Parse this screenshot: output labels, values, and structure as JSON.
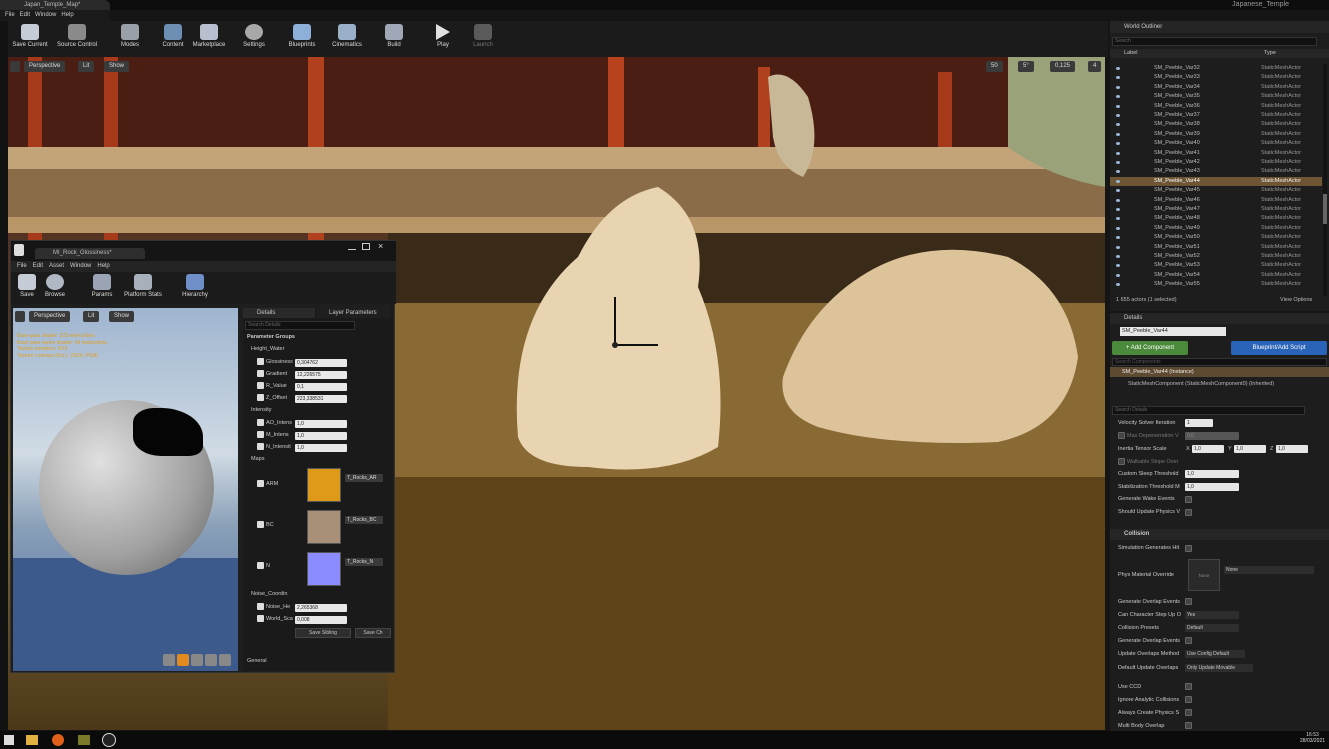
{
  "window": {
    "tab_title": "Japan_Temple_Map*",
    "project_name": "Japanese_Temple"
  },
  "menu": [
    "File",
    "Edit",
    "Window",
    "Help"
  ],
  "toolbar": [
    {
      "label": "Save Current",
      "icon": "save-icon"
    },
    {
      "label": "Source Control",
      "icon": "source-control-icon"
    },
    {
      "label": "Modes",
      "icon": "modes-icon"
    },
    {
      "label": "Content",
      "icon": "content-icon"
    },
    {
      "label": "Marketplace",
      "icon": "marketplace-icon"
    },
    {
      "label": "Settings",
      "icon": "settings-icon"
    },
    {
      "label": "Blueprints",
      "icon": "blueprints-icon"
    },
    {
      "label": "Cinematics",
      "icon": "cinematics-icon"
    },
    {
      "label": "Build",
      "icon": "build-icon"
    },
    {
      "label": "Play",
      "icon": "play-icon"
    },
    {
      "label": "Launch",
      "icon": "launch-icon"
    }
  ],
  "viewport": {
    "perspective": "Perspective",
    "lit": "Lit",
    "show": "Show",
    "grid_snap": "50",
    "rot_snap": "5°",
    "scale_snap": "0,125",
    "cam_speed": "4"
  },
  "material_editor": {
    "tab_title": "MI_Rock_Glossiness*",
    "menu": [
      "File",
      "Edit",
      "Asset",
      "Window",
      "Help"
    ],
    "tools": [
      "Save",
      "Browse",
      "Params",
      "Platform Stats",
      "Hierarchy"
    ],
    "preview": {
      "perspective": "Perspective",
      "lit": "Lit",
      "show": "Show",
      "stats": [
        "Base pass shader: 223 instructions",
        "Base pass vertex shader: 46 instructions",
        "Texture samplers: 5/16",
        "Texture Lookups (Est.): VS(0), PS(4)"
      ]
    },
    "tabs": [
      "Details",
      "Layer Parameters"
    ],
    "search_placeholder": "Search Details",
    "parameter_groups": "Parameter Groups",
    "groups": {
      "height": "Height_Water",
      "intensity": "Intensity",
      "maps": "Maps",
      "noise": "Noise_Coordin",
      "general": "General"
    },
    "height_params": [
      {
        "name": "Glossiness",
        "value": "0,304762"
      },
      {
        "name": "Gradient",
        "value": "12,226575"
      },
      {
        "name": "R_Value",
        "value": "0,1"
      },
      {
        "name": "Z_Offset",
        "value": "223,338531"
      }
    ],
    "intensity_params": [
      {
        "name": "AO_Intens",
        "value": "1,0"
      },
      {
        "name": "M_Intens",
        "value": "1,0"
      },
      {
        "name": "N_Intensit",
        "value": "1,0"
      }
    ],
    "maps": [
      {
        "name": "ARM",
        "texture": "T_Rocks_AR",
        "color": "#e09a1a"
      },
      {
        "name": "BC",
        "texture": "T_Rocks_BC",
        "color": "#a89078"
      },
      {
        "name": "N",
        "texture": "T_Rocks_N",
        "color": "#8a8cff"
      }
    ],
    "noise_params": [
      {
        "name": "Noise_He",
        "value": "2,265368"
      },
      {
        "name": "World_Sca",
        "value": "0,008"
      }
    ],
    "save_sibling": "Save Sibling",
    "save_child": "Save Ch"
  },
  "outliner": {
    "title": "World Outliner",
    "search_placeholder": "Search",
    "col_label": "Label",
    "col_type": "Type",
    "rows": [
      {
        "label": "SM_Peeble_Var32",
        "type": "StaticMeshActor"
      },
      {
        "label": "SM_Peeble_Var33",
        "type": "StaticMeshActor"
      },
      {
        "label": "SM_Peeble_Var34",
        "type": "StaticMeshActor"
      },
      {
        "label": "SM_Peeble_Var35",
        "type": "StaticMeshActor"
      },
      {
        "label": "SM_Peeble_Var36",
        "type": "StaticMeshActor"
      },
      {
        "label": "SM_Peeble_Var37",
        "type": "StaticMeshActor"
      },
      {
        "label": "SM_Peeble_Var38",
        "type": "StaticMeshActor"
      },
      {
        "label": "SM_Peeble_Var39",
        "type": "StaticMeshActor"
      },
      {
        "label": "SM_Peeble_Var40",
        "type": "StaticMeshActor"
      },
      {
        "label": "SM_Peeble_Var41",
        "type": "StaticMeshActor"
      },
      {
        "label": "SM_Peeble_Var42",
        "type": "StaticMeshActor"
      },
      {
        "label": "SM_Peeble_Var43",
        "type": "StaticMeshActor"
      },
      {
        "label": "SM_Peeble_Var44",
        "type": "StaticMeshActor"
      },
      {
        "label": "SM_Peeble_Var45",
        "type": "StaticMeshActor"
      },
      {
        "label": "SM_Peeble_Var46",
        "type": "StaticMeshActor"
      },
      {
        "label": "SM_Peeble_Var47",
        "type": "StaticMeshActor"
      },
      {
        "label": "SM_Peeble_Var48",
        "type": "StaticMeshActor"
      },
      {
        "label": "SM_Peeble_Var49",
        "type": "StaticMeshActor"
      },
      {
        "label": "SM_Peeble_Var50",
        "type": "StaticMeshActor"
      },
      {
        "label": "SM_Peeble_Var51",
        "type": "StaticMeshActor"
      },
      {
        "label": "SM_Peeble_Var52",
        "type": "StaticMeshActor"
      },
      {
        "label": "SM_Peeble_Var53",
        "type": "StaticMeshActor"
      },
      {
        "label": "SM_Peeble_Var54",
        "type": "StaticMeshActor"
      },
      {
        "label": "SM_Peeble_Var55",
        "type": "StaticMeshActor"
      }
    ],
    "selected_label": "SM_Peeble_Var44",
    "footer": "1 655 actors (1 selected)",
    "view_options": "View Options"
  },
  "details": {
    "title": "Details",
    "name_value": "SM_Peeble_Var44",
    "add_component": "+ Add Component",
    "blueprint": "Blueprint/Add Script",
    "search_components": "Search Components",
    "instance": "SM_Peeble_Var44 (Instance)",
    "component": "StaticMeshComponent (StaticMeshComponent0) (Inherited)",
    "search_details": "Search Details",
    "velocity_label": "Velocity Solver Iteration",
    "velocity_value": "1",
    "max_depen_label": "Max Depenetration V",
    "max_depen_value": "0,0",
    "inertia_label": "Inertia Tensor Scale",
    "inertia_x": "1,0",
    "inertia_y": "1,0",
    "inertia_z": "1,0",
    "axis_x": "X",
    "axis_y": "Y",
    "axis_z": "Z",
    "walkable_label": "Walkable Slope Over",
    "sleep_label": "Custom Sleep Threshold",
    "sleep_value": "1,0",
    "stab_label": "Stabilization Threshold M",
    "stab_value": "1,0",
    "wake_label": "Generate Wake Events",
    "update_phys_label": "Should Update Physics V",
    "collision_header": "Collision",
    "sim_hit_label": "Simulation Generates Hit",
    "phys_mat_label": "Phys Material Override",
    "phys_mat_thumb": "None",
    "phys_mat_value": "None",
    "overlap_label": "Generate Overlap Events",
    "step_up_label": "Can Character Step Up O",
    "step_up_value": "Yes",
    "presets_label": "Collision Presets",
    "presets_value": "Default",
    "gen_overlap_label": "Generate Overlap Events",
    "update_method_label": "Update Overlaps Method",
    "update_method_value": "Use Config Default",
    "default_update_label": "Default Update Overlaps",
    "default_update_value": "Only Update Movable",
    "ccd_label": "Use CCD",
    "ignore_label": "Ignore Analytic Collisions",
    "always_label": "Always Create Physics S",
    "multi_label": "Multi Body Overlap"
  },
  "taskbar": {
    "time": "16:53",
    "date": "28/03/2021"
  }
}
